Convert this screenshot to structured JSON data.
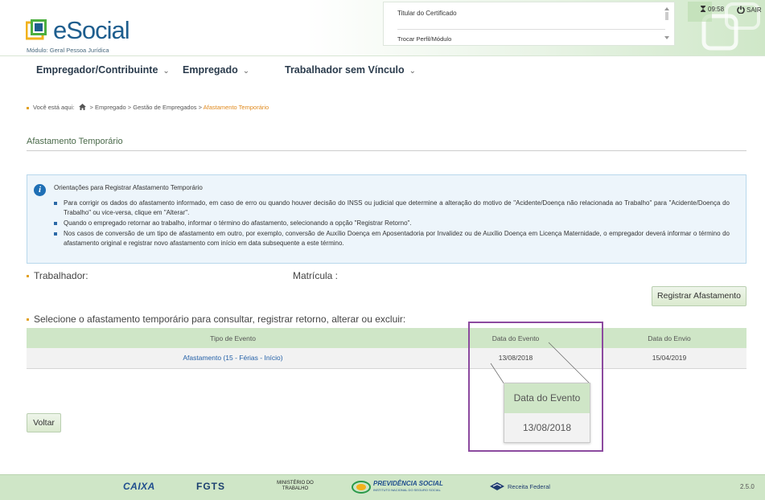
{
  "header": {
    "logo_text": "eSocial",
    "modulo": "Módulo: Geral Pessoa Jurídica",
    "cert_title": "Titular do Certificado",
    "trocar_perfil": "Trocar Perfil/Módulo",
    "time": "09:58",
    "sair": "SAIR"
  },
  "menu": [
    {
      "label": "Empregador/Contribuinte"
    },
    {
      "label": "Empregado"
    },
    {
      "label": "Trabalhador sem Vínculo"
    }
  ],
  "breadcrumb": {
    "prefix": "Você está aqui:",
    "path": "> Empregado > Gestão de Empregados >",
    "current": "Afastamento Temporário"
  },
  "page": {
    "title": "Afastamento Temporário"
  },
  "info": {
    "title": "Orientações para Registrar Afastamento Temporário",
    "items": [
      "Para corrigir os dados do afastamento informado, em caso de erro ou quando houver decisão do INSS ou judicial que determine a alteração do motivo de \"Acidente/Doença não relacionada ao Trabalho\" para \"Acidente/Doença do Trabalho\" ou vice-versa, clique em \"Alterar\".",
      "Quando o empregado retornar ao trabalho, informar o término do afastamento, selecionando a opção \"Registrar Retorno\".",
      "Nos casos de conversão de um tipo de afastamento em outro, por exemplo, conversão de Auxílio Doença em Aposentadoria por Invalidez ou de Auxílio Doença em Licença Maternidade, o empregador deverá informar o término do afastamento original e registrar novo afastamento com início em data subsequente a este término."
    ]
  },
  "fields": {
    "trabalhador": "Trabalhador:",
    "matricula": "Matrícula :"
  },
  "buttons": {
    "registrar": "Registrar Afastamento",
    "voltar": "Voltar"
  },
  "table": {
    "instruction": "Selecione o afastamento temporário para consultar, registrar retorno, alterar ou excluir:",
    "headers": [
      "Tipo de Evento",
      "Data do Evento",
      "Data do Envio"
    ],
    "rows": [
      [
        "Afastamento (15 - Férias - Início)",
        "13/08/2018",
        "15/04/2019"
      ]
    ]
  },
  "zoom": {
    "header": "Data do Evento",
    "value": "13/08/2018"
  },
  "footer": {
    "logos": [
      "CAIXA",
      "FGTS",
      "MINISTÉRIO DO TRABALHO",
      "PREVIDÊNCIA SOCIAL",
      "Receita Federal"
    ],
    "previdencia_sub": "INSTITUTO NACIONAL DO SEGURO SOCIAL",
    "version": "2.5.0"
  },
  "colors": {
    "accent_green": "#cfe6c7",
    "link_blue": "#2460a7",
    "callout_purple": "#8c4a9f",
    "breadcrumb_orange": "#e08a1e"
  }
}
